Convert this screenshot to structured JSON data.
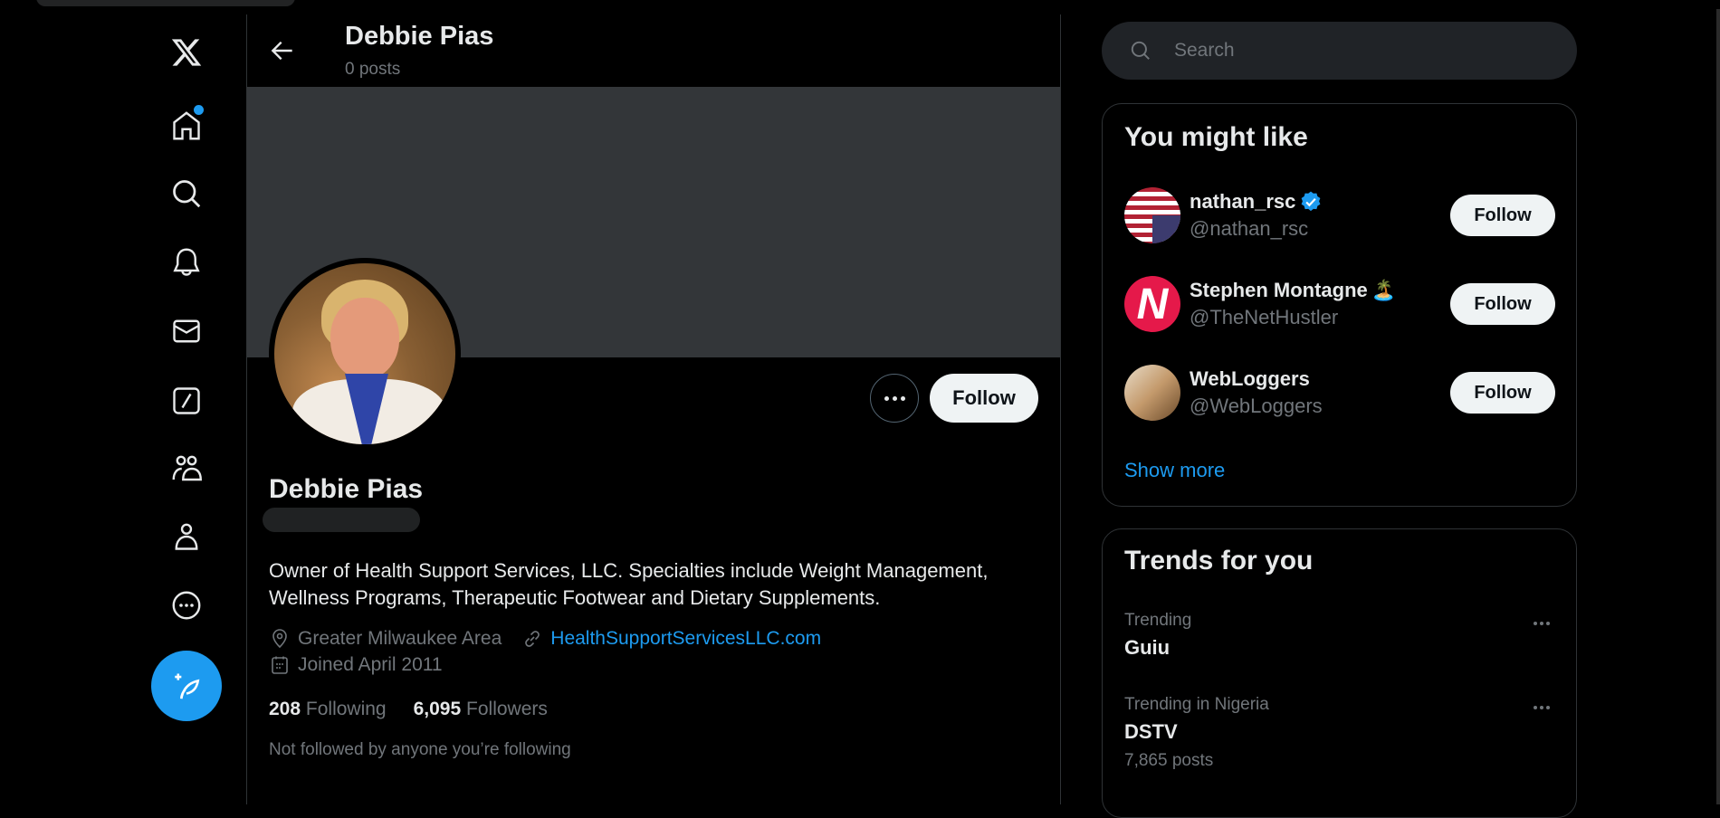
{
  "sidebar": {
    "items": [
      {
        "name": "home",
        "has_notification_dot": true
      },
      {
        "name": "explore"
      },
      {
        "name": "notifications"
      },
      {
        "name": "messages"
      },
      {
        "name": "grok"
      },
      {
        "name": "communities"
      },
      {
        "name": "profile"
      },
      {
        "name": "more"
      }
    ],
    "compose_label": "Post"
  },
  "header": {
    "title": "Debbie Pias",
    "subtitle": "0 posts"
  },
  "profile": {
    "name": "Debbie Pias",
    "bio": "Owner of Health Support Services, LLC. Specialties include Weight Management, Wellness Programs, Therapeutic Footwear and Dietary Supplements.",
    "location": "Greater Milwaukee Area",
    "website": "HealthSupportServicesLLC.com",
    "joined": "Joined April 2011",
    "following_count": "208",
    "following_label": "Following",
    "followers_count": "6,095",
    "followers_label": "Followers",
    "not_followed_text": "Not followed by anyone you’re following",
    "follow_label": "Follow"
  },
  "search": {
    "placeholder": "Search"
  },
  "who_to_follow": {
    "title": "You might like",
    "users": [
      {
        "name": "nathan_rsc",
        "handle": "@nathan_rsc",
        "verified": true,
        "emoji": "",
        "follow_label": "Follow"
      },
      {
        "name": "Stephen Montagne",
        "handle": "@TheNetHustler",
        "verified": false,
        "emoji": "🏝️",
        "follow_label": "Follow"
      },
      {
        "name": "WebLoggers",
        "handle": "@WebLoggers",
        "verified": false,
        "emoji": "",
        "follow_label": "Follow"
      }
    ],
    "show_more": "Show more"
  },
  "trends": {
    "title": "Trends for you",
    "items": [
      {
        "context": "Trending",
        "name": "Guiu",
        "count": ""
      },
      {
        "context": "Trending in Nigeria",
        "name": "DSTV",
        "count": "7,865 posts"
      }
    ]
  },
  "colors": {
    "accent": "#1d9bf0",
    "background": "#000000",
    "banner": "#333639"
  }
}
